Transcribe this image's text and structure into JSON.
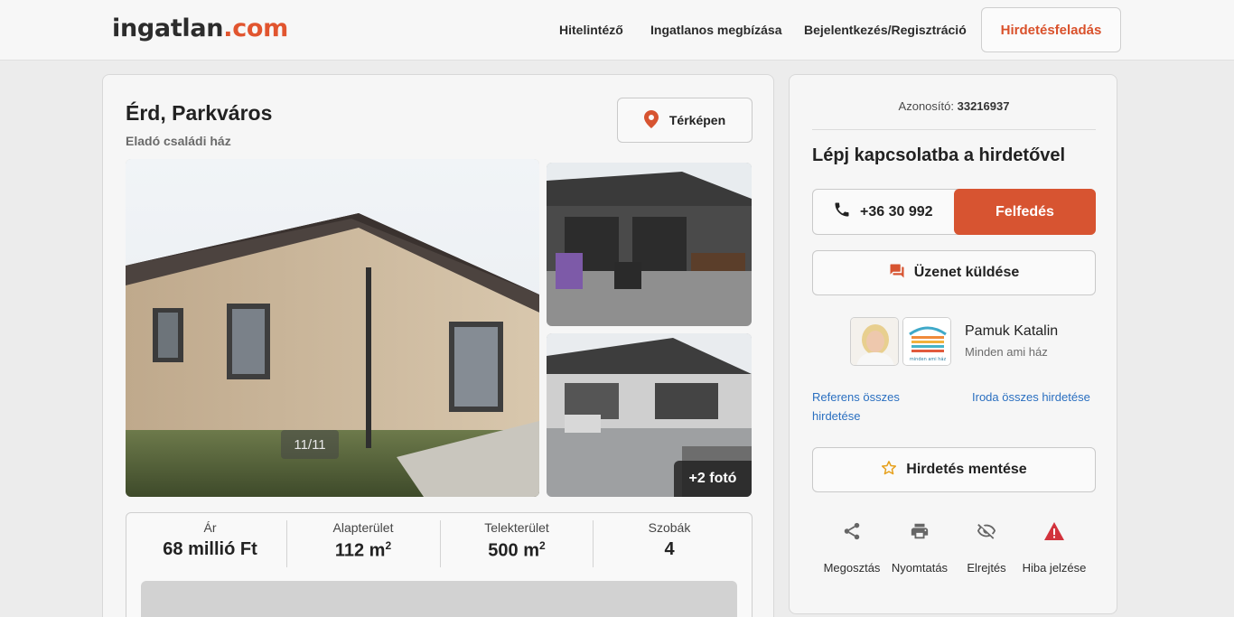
{
  "header": {
    "logo_part1": "ingatlan",
    "logo_part2": ".com",
    "nav": [
      "Hitelintéző",
      "Ingatlanos megbízása",
      "Bejelentkezés/Regisztráció"
    ],
    "post_button": "Hirdetésfeladás"
  },
  "listing": {
    "title": "Érd, Parkváros",
    "subtitle": "Eladó családi ház",
    "map_button": "Térképen",
    "photo_counter": "11/11",
    "more_photos": "+2 fotó",
    "facts": [
      {
        "label": "Ár",
        "value": "68 millió Ft",
        "unit": ""
      },
      {
        "label": "Alapterület",
        "value": "112 m",
        "unit": "2"
      },
      {
        "label": "Telekterület",
        "value": "500 m",
        "unit": "2"
      },
      {
        "label": "Szobák",
        "value": "4",
        "unit": ""
      }
    ]
  },
  "contact": {
    "id_label": "Azonosító:",
    "id_value": "33216937",
    "title": "Lépj kapcsolatba a hirdetővel",
    "phone": "+36 30 992",
    "reveal_button": "Felfedés",
    "message_button": "Üzenet küldése",
    "agent_name": "Pamuk Katalin",
    "agent_office": "Minden ami ház",
    "office_logo_text": "minden ami ház",
    "link_referent": "Referens összes hirdetése",
    "link_office": "Iroda összes hirdetése",
    "save_button": "Hirdetés mentése",
    "actions": [
      "Megosztás",
      "Nyomtatás",
      "Elrejtés",
      "Hiba jelzése"
    ]
  },
  "colors": {
    "accent": "#d75431",
    "link": "#2a6fc0",
    "warning": "#d2323c"
  }
}
